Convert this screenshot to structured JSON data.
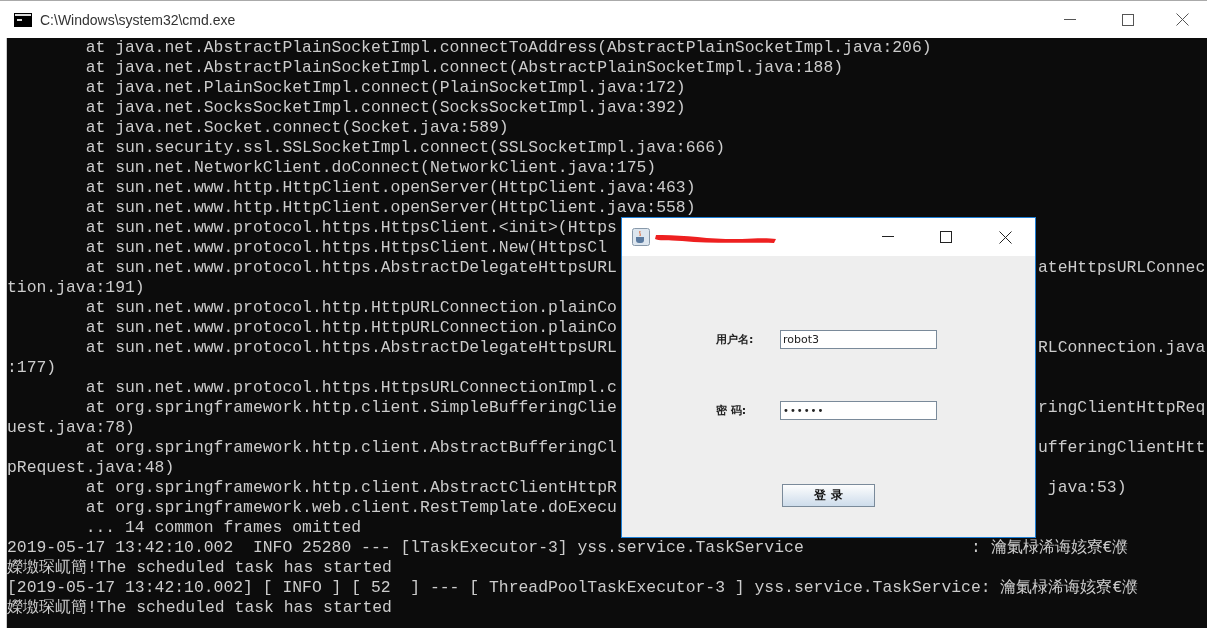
{
  "window": {
    "title": "C:\\Windows\\system32\\cmd.exe"
  },
  "console": {
    "lines": [
      {
        "text": "        at java.net.AbstractPlainSocketImpl.connectToAddress(AbstractPlainSocketImpl.java:206)"
      },
      {
        "text": "        at java.net.AbstractPlainSocketImpl.connect(AbstractPlainSocketImpl.java:188)"
      },
      {
        "text": "        at java.net.PlainSocketImpl.connect(PlainSocketImpl.java:172)"
      },
      {
        "text": "        at java.net.SocksSocketImpl.connect(SocksSocketImpl.java:392)"
      },
      {
        "text": "        at java.net.Socket.connect(Socket.java:589)"
      },
      {
        "text": "        at sun.security.ssl.SSLSocketImpl.connect(SSLSocketImpl.java:666)"
      },
      {
        "text": "        at sun.net.NetworkClient.doConnect(NetworkClient.java:175)"
      },
      {
        "text": "        at sun.net.www.http.HttpClient.openServer(HttpClient.java:463)"
      },
      {
        "text": "        at sun.net.www.http.HttpClient.openServer(HttpClient.java:558)"
      },
      {
        "text": "        at sun.net.www.protocol.https.HttpsClient.<init>(Https"
      },
      {
        "text": "        at sun.net.www.protocol.https.HttpsClient.New(HttpsCl"
      },
      {
        "text": "        at sun.net.www.protocol.https.AbstractDelegateHttpsURL",
        "right": "ateHttpsURLConnec"
      },
      {
        "text": "tion.java:191)"
      },
      {
        "text": "        at sun.net.www.protocol.http.HttpURLConnection.plainCo"
      },
      {
        "text": "        at sun.net.www.protocol.http.HttpURLConnection.plainCo"
      },
      {
        "text": "        at sun.net.www.protocol.https.AbstractDelegateHttpsURL",
        "right": "RLConnection.java"
      },
      {
        "text": ":177)"
      },
      {
        "text": "        at sun.net.www.protocol.https.HttpsURLConnectionImpl.c"
      },
      {
        "text": "        at org.springframework.http.client.SimpleBufferingClie",
        "right": "ringClientHttpReq"
      },
      {
        "text": "uest.java:78)"
      },
      {
        "text": "        at org.springframework.http.client.AbstractBufferingCl",
        "right": "ufferingClientHtt"
      },
      {
        "text": "pRequest.java:48)"
      },
      {
        "text": "        at org.springframework.http.client.AbstractClientHttpR",
        "right": " java:53)"
      },
      {
        "text": "        at org.springframework.web.client.RestTemplate.doExecu"
      },
      {
        "text": "        ... 14 common frames omitted"
      },
      {
        "text": "2019-05-17 13:42:10.002  INFO 25280 --- [lTaskExecutor-3] yss.service.TaskService                 : 瀹氭椂浠诲姟寮€濮"
      },
      {
        "text": "嬫墽琛屼簡!The scheduled task has started"
      },
      {
        "text": "[2019-05-17 13:42:10.002] [ INFO ] [ 52  ] --- [ ThreadPoolTaskExecutor-3 ] yss.service.TaskService: 瀹氭椂浠诲姟寮€濮"
      },
      {
        "text": "嬫墽琛屼簡!The scheduled task has started"
      }
    ]
  },
  "dialog": {
    "title_redacted": true,
    "fields": [
      {
        "label": "用户名:",
        "kind": "text",
        "value": "robot3"
      },
      {
        "label": "密 码:",
        "kind": "password",
        "value": "••••••"
      }
    ],
    "button": "登 录"
  }
}
